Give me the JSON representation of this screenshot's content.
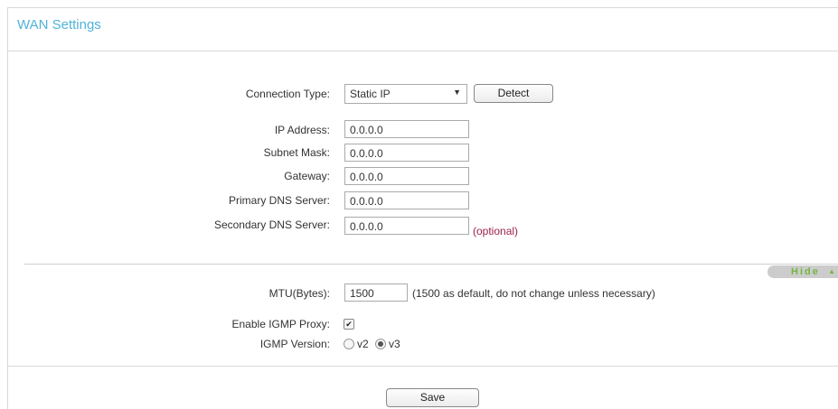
{
  "panel": {
    "title": "WAN Settings"
  },
  "connection": {
    "label": "Connection Type:",
    "value": "Static IP",
    "detect_label": "Detect"
  },
  "fields": {
    "ip": {
      "label": "IP Address:",
      "value": "0.0.0.0"
    },
    "subnet": {
      "label": "Subnet Mask:",
      "value": "0.0.0.0"
    },
    "gateway": {
      "label": "Gateway:",
      "value": "0.0.0.0"
    },
    "dns1": {
      "label": "Primary DNS Server:",
      "value": "0.0.0.0"
    },
    "dns2": {
      "label": "Secondary DNS Server:",
      "value": "0.0.0.0",
      "note": "(optional)"
    }
  },
  "advanced": {
    "toggle_label": "Hide",
    "mtu_label": "MTU(Bytes):",
    "mtu_value": "1500",
    "mtu_hint": "(1500 as default, do not change unless necessary)",
    "igmp_proxy_label": "Enable IGMP Proxy:",
    "igmp_proxy_checked": true,
    "igmp_version_label": "IGMP Version:",
    "igmp_v2": "v2",
    "igmp_v3": "v3",
    "igmp_selected": "v3"
  },
  "save_label": "Save",
  "colors": {
    "title": "#4fb3d9",
    "optional": "#9b2146",
    "toggle_text": "#75b640"
  }
}
